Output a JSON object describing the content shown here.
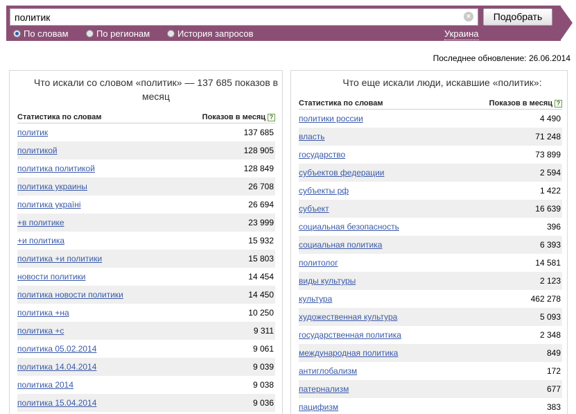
{
  "search": {
    "value": "политик",
    "clear_icon": "clear-icon",
    "submit_label": "Подобрать"
  },
  "modes": [
    {
      "label": "По словам",
      "selected": true
    },
    {
      "label": "По регионам",
      "selected": false
    },
    {
      "label": "История запросов",
      "selected": false
    }
  ],
  "region": "Украина",
  "updated": "Последнее обновление: 26.06.2014",
  "left_panel": {
    "title": "Что искали со словом «политик» — 137 685 показов в месяц",
    "col_words": "Статистика по словам",
    "col_shows": "Показов в месяц",
    "help_icon": "?",
    "rows": [
      {
        "phrase": "политик",
        "count": "137 685"
      },
      {
        "phrase": "политикой",
        "count": "128 905"
      },
      {
        "phrase": "политика политикой",
        "count": "128 849"
      },
      {
        "phrase": "политика украины",
        "count": "26 708"
      },
      {
        "phrase": "политика україні",
        "count": "26 694"
      },
      {
        "phrase": "+в политике",
        "count": "23 999"
      },
      {
        "phrase": "+и политика",
        "count": "15 932"
      },
      {
        "phrase": "политика +и политики",
        "count": "15 803"
      },
      {
        "phrase": "новости политики",
        "count": "14 454"
      },
      {
        "phrase": "политика новости политики",
        "count": "14 450"
      },
      {
        "phrase": "политика +на",
        "count": "10 250"
      },
      {
        "phrase": "политика +с",
        "count": "9 311"
      },
      {
        "phrase": "политика 05.02.2014",
        "count": "9 061"
      },
      {
        "phrase": "политика 14.04.2014",
        "count": "9 039"
      },
      {
        "phrase": "политика 2014",
        "count": "9 038"
      },
      {
        "phrase": "политика 15.04.2014",
        "count": "9 036"
      }
    ]
  },
  "right_panel": {
    "title": "Что еще искали люди, искавшие «политик»:",
    "col_words": "Статистика по словам",
    "col_shows": "Показов в месяц",
    "help_icon": "?",
    "rows": [
      {
        "phrase": "политики россии",
        "count": "4 490"
      },
      {
        "phrase": "власть",
        "count": "71 248"
      },
      {
        "phrase": "государство",
        "count": "73 899"
      },
      {
        "phrase": "субъектов федерации",
        "count": "2 594"
      },
      {
        "phrase": "субъекты рф",
        "count": "1 422"
      },
      {
        "phrase": "субъект",
        "count": "16 639"
      },
      {
        "phrase": "социальная безопасность",
        "count": "396"
      },
      {
        "phrase": "социальная политика",
        "count": "6 393"
      },
      {
        "phrase": "политолог",
        "count": "14 581"
      },
      {
        "phrase": "виды культуры",
        "count": "2 123"
      },
      {
        "phrase": "культура",
        "count": "462 278"
      },
      {
        "phrase": "художественная культура",
        "count": "5 093"
      },
      {
        "phrase": "государственная политика",
        "count": "2 348"
      },
      {
        "phrase": "международная политика",
        "count": "849"
      },
      {
        "phrase": "антиглобализм",
        "count": "172"
      },
      {
        "phrase": "патернализм",
        "count": "677"
      },
      {
        "phrase": "пацифизм",
        "count": "383"
      }
    ]
  }
}
